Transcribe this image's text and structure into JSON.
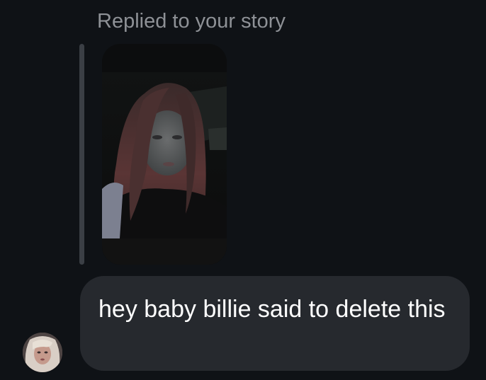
{
  "reply": {
    "caption": "Replied to your story"
  },
  "story_preview": {
    "icon": "story-photo-thumbnail"
  },
  "message": {
    "text": "hey baby billie said to delete this",
    "sender_avatar_icon": "avatar-photo"
  },
  "colors": {
    "background": "#0f1216",
    "bubble": "#26292e",
    "caption_text": "#8e9196",
    "quote_bar": "#3b3f45",
    "message_text": "#ffffff"
  }
}
